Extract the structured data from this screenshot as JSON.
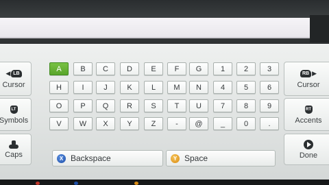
{
  "left_buttons": [
    {
      "id": "cursor-left",
      "icon": "lb-bumper-icon",
      "badge": "LB",
      "arrow": "◀",
      "label": "Cursor"
    },
    {
      "id": "symbols",
      "icon": "lt-trigger-icon",
      "badge": "LT",
      "label": "Symbols"
    },
    {
      "id": "caps",
      "icon": "left-stick-icon",
      "label": "Caps"
    }
  ],
  "right_buttons": [
    {
      "id": "cursor-right",
      "icon": "rb-bumper-icon",
      "badge": "RB",
      "arrow": "▶",
      "label": "Cursor"
    },
    {
      "id": "accents",
      "icon": "rt-trigger-icon",
      "badge": "RT",
      "label": "Accents"
    },
    {
      "id": "done",
      "icon": "start-button-icon",
      "label": "Done"
    }
  ],
  "key_rows": [
    [
      "A",
      "B",
      "C",
      "D",
      "E",
      "F",
      "G",
      "1",
      "2",
      "3"
    ],
    [
      "H",
      "I",
      "J",
      "K",
      "L",
      "M",
      "N",
      "4",
      "5",
      "6"
    ],
    [
      "O",
      "P",
      "Q",
      "R",
      "S",
      "T",
      "U",
      "7",
      "8",
      "9"
    ],
    [
      "V",
      "W",
      "X",
      "Y",
      "Z",
      "-",
      "@",
      "_",
      "0",
      "."
    ]
  ],
  "selected_key": "A",
  "bottom_keys": {
    "backspace": {
      "badge": "X",
      "label": "Backspace",
      "color": "#1e4fa8"
    },
    "space": {
      "badge": "Y",
      "label": "Space",
      "color": "#d98c14"
    }
  },
  "colors": {
    "selected": "#5aa52b",
    "panel": "#e3e6e5",
    "screen": "#1b1d1e"
  }
}
